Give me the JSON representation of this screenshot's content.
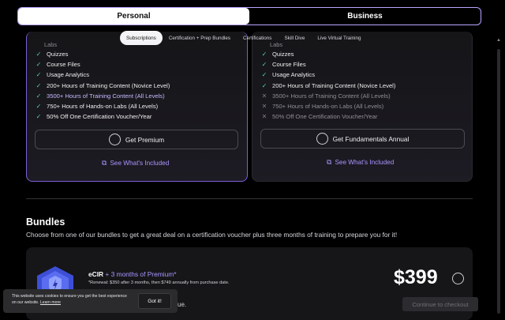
{
  "plan_toggle": {
    "personal": "Personal",
    "business": "Business"
  },
  "subnav": {
    "tabs": [
      "Subscriptions",
      "Certification + Prep Bundles",
      "Certifications",
      "Skill Dive",
      "Live Virtual Training"
    ],
    "active": "Subscriptions"
  },
  "premium_card": {
    "cut_text": "Labs",
    "features": [
      {
        "icon": "check-icon",
        "text": "Quizzes"
      },
      {
        "icon": "check-icon",
        "text": "Course Files"
      },
      {
        "icon": "check-icon",
        "text": "Usage Analytics"
      },
      {
        "icon": "check-icon",
        "text": "200+ Hours of Training Content (Novice Level)"
      },
      {
        "icon": "check-icon",
        "text": "3500+ Hours of Training Content (All Levels)"
      },
      {
        "icon": "check-icon",
        "text": "750+ Hours of Hands-on Labs (All Levels)"
      },
      {
        "icon": "check-icon",
        "text": "50% Off One Certification Voucher/Year"
      }
    ],
    "cta": "Get Premium",
    "link": "See What's Included"
  },
  "fundamentals_card": {
    "cut_text": "Labs",
    "features": [
      {
        "icon": "check-icon",
        "text": "Quizzes"
      },
      {
        "icon": "check-icon",
        "text": "Course Files"
      },
      {
        "icon": "check-icon",
        "text": "Usage Analytics"
      },
      {
        "icon": "check-icon",
        "text": "200+ Hours of Training Content (Novice Level)"
      },
      {
        "icon": "cross-icon",
        "text": "3500+ Hours of Training Content (All Levels)"
      },
      {
        "icon": "cross-icon",
        "text": "750+ Hours of Hands-on Labs (All Levels)"
      },
      {
        "icon": "cross-icon",
        "text": "50% Off One Certification Voucher/Year"
      }
    ],
    "cta": "Get Fundamentals Annual",
    "link": "See What's Included"
  },
  "bundles": {
    "title": "Bundles",
    "subtitle": "Choose from one of our bundles to get a great deal on a certification voucher plus three months of training to prepare you for it!",
    "item": {
      "name": "eCIR",
      "plus": " + 3 months of Premium*",
      "note": "*Renewal: $350 after 3 months, then $749 annually from purchase date.",
      "price": "$399",
      "more": "ue."
    },
    "checkout": "Continue to checkout"
  },
  "cookie": {
    "text": "This website uses cookies to ensure you get the best experience on our website.",
    "learn_more": "Learn more",
    "button": "Got it!"
  },
  "colors": {
    "accent": "#a996ff",
    "check": "#4ad6a7",
    "background": "#000000"
  }
}
